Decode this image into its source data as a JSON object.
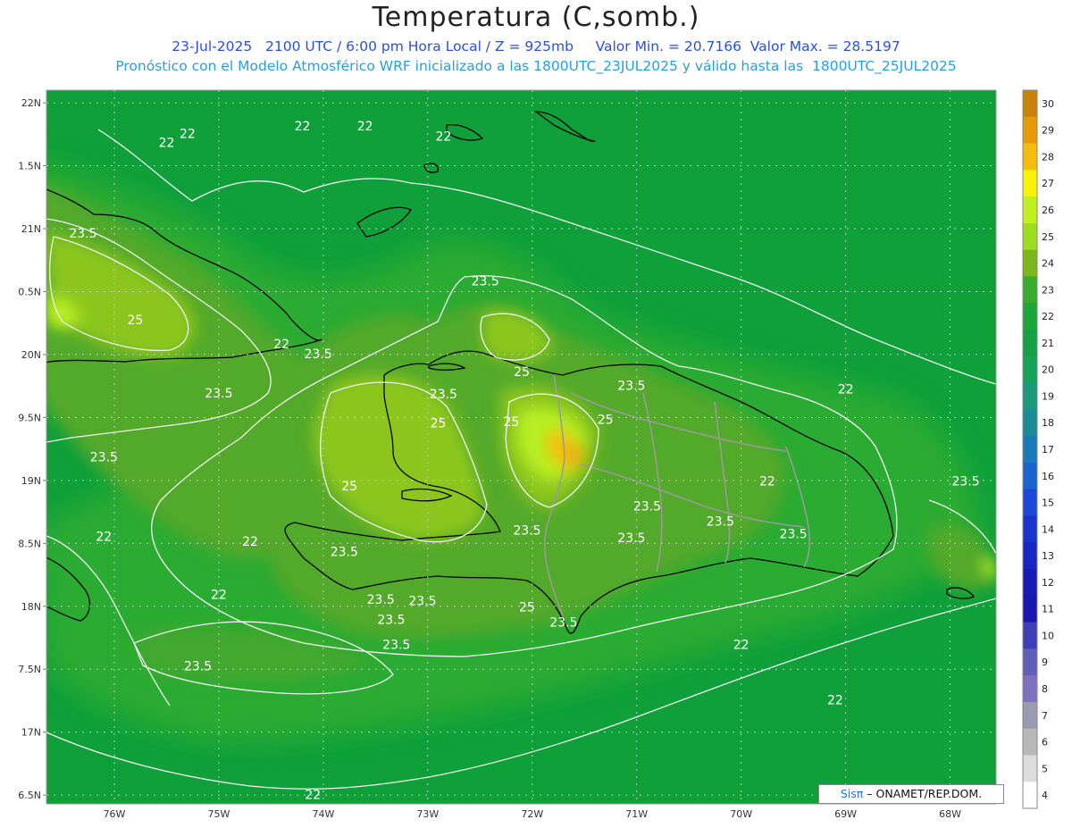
{
  "header": {
    "title": "Temperatura (C,somb.)",
    "line1": "23-Jul-2025   2100 UTC / 6:00 pm Hora Local / Z = 925mb     Valor Min. = 20.7166  Valor Max. = 28.5197",
    "line2": "Pronóstico con el Modelo Atmosférico WRF inicializado a las 1800UTC_23JUL2025 y válido hasta las  1800UTC_25JUL2025"
  },
  "map": {
    "lat_labels": [
      "22N",
      "1.5N",
      "21N",
      "0.5N",
      "20N",
      "9.5N",
      "19N",
      "8.5N",
      "18N",
      "7.5N",
      "17N",
      "6.5N"
    ],
    "lon_labels": [
      "76W",
      "75W",
      "74W",
      "73W",
      "72W",
      "71W",
      "70W",
      "69W",
      "68W"
    ],
    "contour_labels": [
      {
        "text": "22",
        "lon": -75.5,
        "lat": 21.65
      },
      {
        "text": "22",
        "lon": -75.3,
        "lat": 21.72
      },
      {
        "text": "22",
        "lon": -74.2,
        "lat": 21.78
      },
      {
        "text": "22",
        "lon": -73.6,
        "lat": 21.78
      },
      {
        "text": "22",
        "lon": -72.85,
        "lat": 21.7
      },
      {
        "text": "23.5",
        "lon": -76.3,
        "lat": 20.93
      },
      {
        "text": "25",
        "lon": -77.05,
        "lat": 20.62
      },
      {
        "text": "25",
        "lon": -75.8,
        "lat": 20.24
      },
      {
        "text": "22",
        "lon": -74.4,
        "lat": 20.05
      },
      {
        "text": "23.5",
        "lon": -74.05,
        "lat": 19.97
      },
      {
        "text": "23.5",
        "lon": -77.2,
        "lat": 19.8
      },
      {
        "text": "23.5",
        "lon": -75.0,
        "lat": 19.66
      },
      {
        "text": "23.5",
        "lon": -72.45,
        "lat": 20.55
      },
      {
        "text": "25",
        "lon": -72.1,
        "lat": 19.83
      },
      {
        "text": "23.5",
        "lon": -72.85,
        "lat": 19.65
      },
      {
        "text": "25",
        "lon": -72.9,
        "lat": 19.42
      },
      {
        "text": "25",
        "lon": -72.2,
        "lat": 19.43
      },
      {
        "text": "25",
        "lon": -71.3,
        "lat": 19.45
      },
      {
        "text": "23.5",
        "lon": -71.05,
        "lat": 19.72
      },
      {
        "text": "22",
        "lon": -69.0,
        "lat": 19.69
      },
      {
        "text": "23.5",
        "lon": -76.1,
        "lat": 19.15
      },
      {
        "text": "25",
        "lon": -73.75,
        "lat": 18.92
      },
      {
        "text": "22",
        "lon": -69.75,
        "lat": 18.96
      },
      {
        "text": "23.5",
        "lon": -67.85,
        "lat": 18.96
      },
      {
        "text": "23.5",
        "lon": -70.9,
        "lat": 18.76
      },
      {
        "text": "23.5",
        "lon": -70.2,
        "lat": 18.64
      },
      {
        "text": "23.5",
        "lon": -72.05,
        "lat": 18.57
      },
      {
        "text": "22",
        "lon": -76.1,
        "lat": 18.52
      },
      {
        "text": "22",
        "lon": -74.7,
        "lat": 18.48
      },
      {
        "text": "23.5",
        "lon": -73.8,
        "lat": 18.4
      },
      {
        "text": "23.5",
        "lon": -71.05,
        "lat": 18.51
      },
      {
        "text": "23.5",
        "lon": -69.5,
        "lat": 18.54
      },
      {
        "text": "23.5",
        "lon": -73.45,
        "lat": 18.02
      },
      {
        "text": "22",
        "lon": -75.0,
        "lat": 18.06
      },
      {
        "text": "23.5",
        "lon": -73.05,
        "lat": 18.01
      },
      {
        "text": "23.5",
        "lon": -73.35,
        "lat": 17.86
      },
      {
        "text": "25",
        "lon": -72.05,
        "lat": 17.96
      },
      {
        "text": "23.5",
        "lon": -71.7,
        "lat": 17.84
      },
      {
        "text": "23.5",
        "lon": -73.3,
        "lat": 17.66
      },
      {
        "text": "22",
        "lon": -70.0,
        "lat": 17.66
      },
      {
        "text": "23.5",
        "lon": -75.2,
        "lat": 17.49
      },
      {
        "text": "22",
        "lon": -69.1,
        "lat": 17.22
      },
      {
        "text": "22",
        "lon": -74.1,
        "lat": 16.47
      }
    ]
  },
  "colorbar": {
    "labels": [
      "30",
      "29",
      "28",
      "27",
      "26",
      "25",
      "24",
      "23",
      "22",
      "21",
      "20",
      "19",
      "18",
      "17",
      "16",
      "15",
      "14",
      "13",
      "12",
      "11",
      "10",
      "9",
      "8",
      "7",
      "6",
      "5",
      "4"
    ],
    "colors": [
      "#c8820a",
      "#e69a0a",
      "#f5bc10",
      "#f8f20a",
      "#c0f020",
      "#9edc22",
      "#7cb618",
      "#3aaa2c",
      "#1ea63a",
      "#14a044",
      "#16a35a",
      "#1a9a7a",
      "#1a8c95",
      "#1a7ab8",
      "#1a64d0",
      "#1a48d8",
      "#1834cc",
      "#1826c4",
      "#1a1ab8",
      "#1818b0",
      "#3f3fb8",
      "#6060b8",
      "#8070c0",
      "#9a9ab0",
      "#b8b8b8",
      "#dcdcdc",
      "#ffffff"
    ]
  },
  "credit": {
    "logo": "Sisπ",
    "org": "– ONAMET/REP.DOM."
  }
}
